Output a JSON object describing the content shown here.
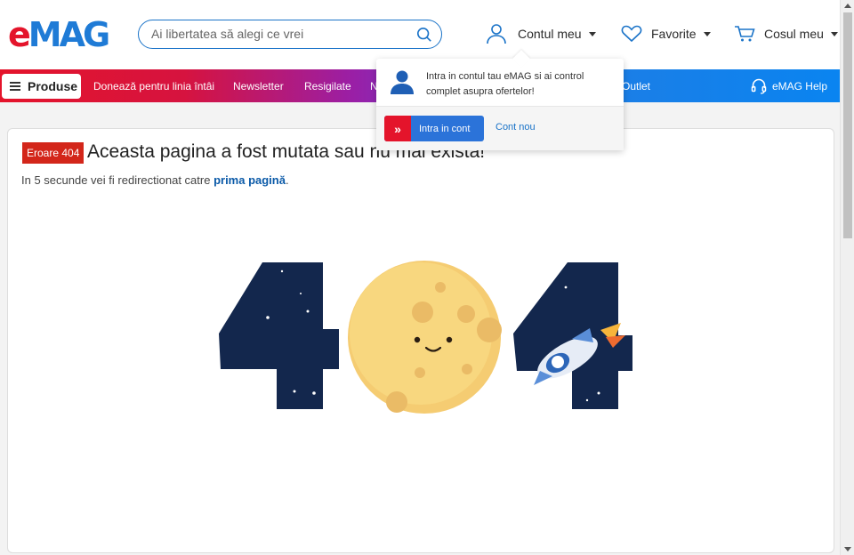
{
  "header": {
    "logo_e": "e",
    "logo_mag": "MAG",
    "search_placeholder": "Ai libertatea să alegi ce vrei",
    "account": "Contul meu",
    "favorites": "Favorite",
    "cart": "Cosul meu"
  },
  "nav": {
    "produse": "Produse",
    "items": [
      "Donează pentru linia întâi",
      "Newsletter",
      "Resigilate",
      "N",
      "Outlet"
    ],
    "help": "eMAG Help"
  },
  "error": {
    "badge": "Eroare 404",
    "title": "Aceasta pagina a fost mutata sau nu mai exista!",
    "sub_prefix": "In 5 secunde vei fi redirectionat catre ",
    "sub_link": "prima pagină",
    "sub_suffix": "."
  },
  "popover": {
    "text": "Intra in contul tau eMAG si ai control complet asupra ofertelor!",
    "login_button": "Intra in cont",
    "new_account": "Cont nou"
  },
  "colors": {
    "brand_red": "#e4142b",
    "brand_blue": "#1f7bd6"
  }
}
